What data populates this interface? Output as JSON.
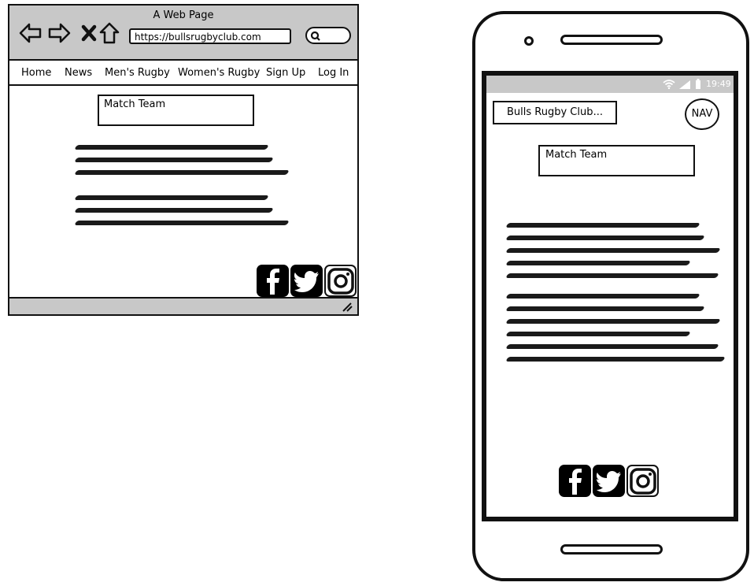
{
  "desktop": {
    "window_title": "A Web Page",
    "url": "https://bullsrugbyclub.com",
    "nav_items": [
      "Home",
      "News",
      "Men's Rugby",
      "Women's Rugby",
      "Sign Up",
      "Log In"
    ],
    "match_team_label": "Match Team"
  },
  "mobile": {
    "status_time": "19:49",
    "club_name": "Bulls Rugby Club",
    "club_ellipsis": "...",
    "nav_button": "NAV",
    "match_team_label": "Match Team"
  },
  "social_icons": [
    "facebook-icon",
    "twitter-icon",
    "instagram-icon"
  ],
  "colors": {
    "chrome_gray": "#c8c8c8",
    "ink": "#111111"
  }
}
